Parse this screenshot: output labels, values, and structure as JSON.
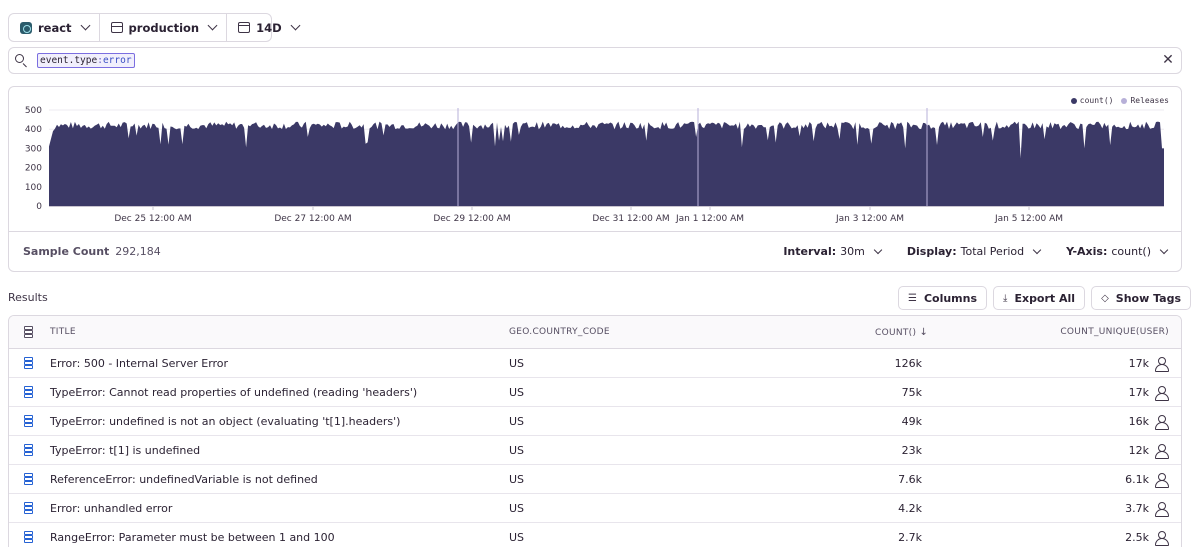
{
  "filters": {
    "project": "react",
    "environment": "production",
    "period": "14D"
  },
  "search": {
    "key": "event.type",
    "operator": ":",
    "value": "error"
  },
  "chart_data": {
    "type": "area",
    "y_ticks": [
      "500",
      "400",
      "300",
      "200",
      "100",
      "0"
    ],
    "x_ticks": [
      "Dec 25 12:00 AM",
      "Dec 27 12:00 AM",
      "Dec 29 12:00 AM",
      "Dec 31 12:00 AM",
      "Jan 1 12:00 AM",
      "Jan 3 12:00 AM",
      "Jan 5 12:00 AM"
    ],
    "ylim": [
      0,
      500
    ],
    "typical_value": 420,
    "series": [
      {
        "name": "count()",
        "color": "#3b3966"
      }
    ],
    "releases_label": "Releases",
    "releases_color": "#b7b0d8",
    "grid": true,
    "legend_position": "top-right"
  },
  "footer": {
    "sample_label": "Sample Count",
    "sample_value": "292,184",
    "interval_label": "Interval:",
    "interval_value": "30m",
    "display_label": "Display:",
    "display_value": "Total Period",
    "yaxis_label": "Y-Axis:",
    "yaxis_value": "count()"
  },
  "results": {
    "title": "Results",
    "columns_button": "Columns",
    "export_button": "Export All",
    "tags_button": "Show Tags"
  },
  "table": {
    "headers": {
      "title": "TITLE",
      "country": "GEO.COUNTRY_CODE",
      "count": "COUNT()",
      "unique": "COUNT_UNIQUE(USER)"
    },
    "rows": [
      {
        "title": "Error: 500 - Internal Server Error",
        "country": "US",
        "count": "126k",
        "unique": "17k"
      },
      {
        "title": "TypeError: Cannot read properties of undefined (reading 'headers')",
        "country": "US",
        "count": "75k",
        "unique": "17k"
      },
      {
        "title": "TypeError: undefined is not an object (evaluating 't[1].headers')",
        "country": "US",
        "count": "49k",
        "unique": "16k"
      },
      {
        "title": "TypeError: t[1] is undefined",
        "country": "US",
        "count": "23k",
        "unique": "12k"
      },
      {
        "title": "ReferenceError: undefinedVariable is not defined",
        "country": "US",
        "count": "7.6k",
        "unique": "6.1k"
      },
      {
        "title": "Error: unhandled error",
        "country": "US",
        "count": "4.2k",
        "unique": "3.7k"
      },
      {
        "title": "RangeError: Parameter must be between 1 and 100",
        "country": "US",
        "count": "2.7k",
        "unique": "2.5k"
      }
    ]
  }
}
